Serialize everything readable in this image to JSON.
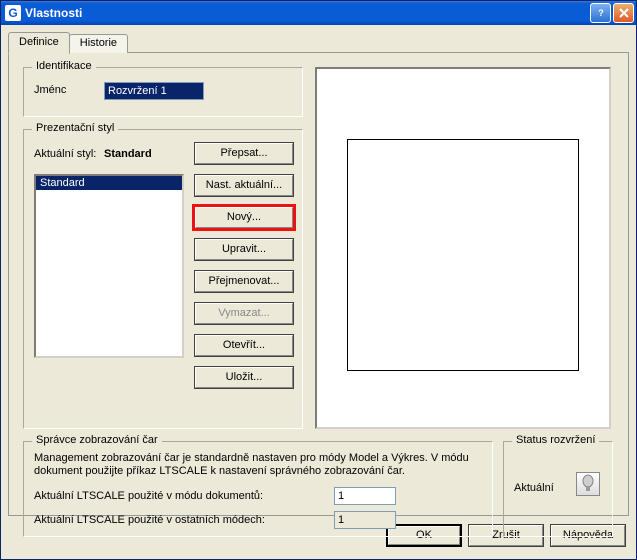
{
  "window": {
    "title": "Vlastnosti"
  },
  "tabs": {
    "defs": "Definice",
    "hist": "Historie"
  },
  "ident": {
    "group": "Identifikace",
    "name_label": "Jménc",
    "name_value": "Rozvržení 1"
  },
  "pres": {
    "group": "Prezentační styl",
    "current_label": "Aktuální styl:",
    "current_value": "Standard",
    "list_item": "Standard",
    "btn_overwrite": "Přepsat...",
    "btn_setcurrent": "Nast. aktuální...",
    "btn_new": "Nový...",
    "btn_edit": "Upravit...",
    "btn_rename": "Přejmenovat...",
    "btn_delete": "Vymazat...",
    "btn_open": "Otevřít...",
    "btn_save": "Uložit..."
  },
  "linemgr": {
    "group": "Správce zobrazování čar",
    "desc": "Management zobrazování čar je standardně nastaven pro módy Model a Výkres. V módu dokument použijte příkaz LTSCALE k nastavení správného zobrazování čar.",
    "lt_doc_label": "Aktuální LTSCALE použité v módu dokumentů:",
    "lt_doc_value": "1",
    "lt_other_label": "Aktuální LTSCALE použité v ostatních módech:",
    "lt_other_value": "1"
  },
  "status": {
    "group": "Status rozvržení",
    "label": "Aktuální"
  },
  "dlg": {
    "ok": "OK",
    "cancel": "Zrušit",
    "help": "Nápověda"
  }
}
